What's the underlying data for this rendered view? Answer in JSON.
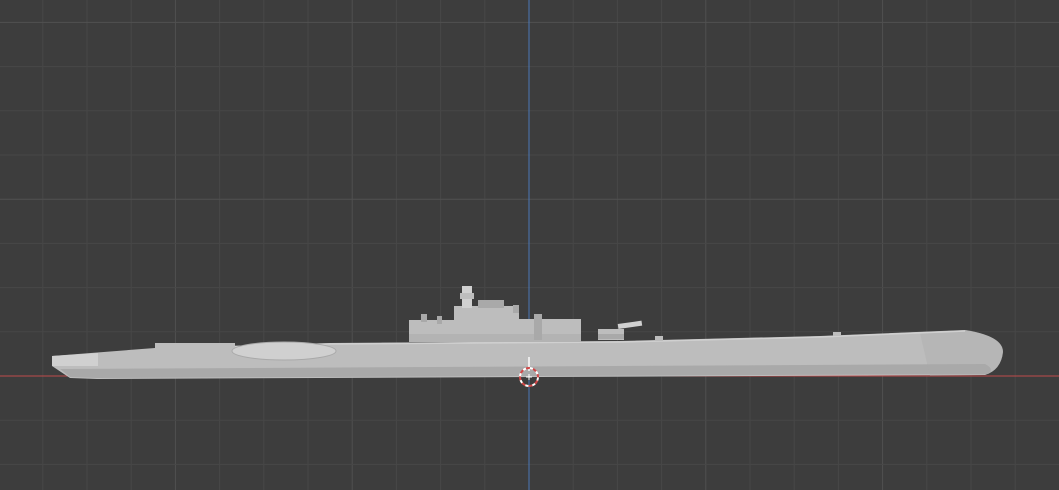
{
  "viewport": {
    "view": "orthographic-side",
    "background_color": "#3d3d3d",
    "grid": {
      "minor_color": "#474747",
      "major_color": "#515151"
    },
    "axes": {
      "x_axis_color": "#c04a4a",
      "z_axis_color": "#4a78b8"
    }
  },
  "model": {
    "object": "submarine",
    "hull_color": "#bdbdbd",
    "hull_shadow_color": "#a9a9a9",
    "hull_highlight_color": "#d0d0d0"
  },
  "cursor_3d": {
    "icon": "3d-cursor-icon",
    "ring_color_a": "#ffffff",
    "ring_color_b": "#d14848"
  }
}
